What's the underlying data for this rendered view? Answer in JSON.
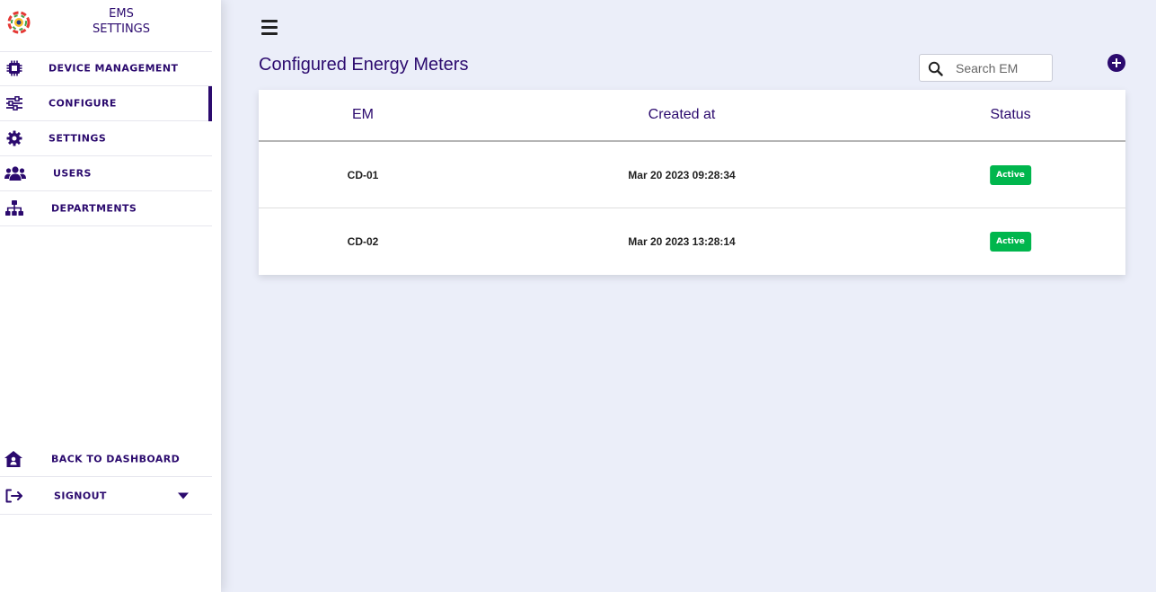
{
  "brand": {
    "line1": "EMS",
    "line2": "SETTINGS"
  },
  "sidebar": {
    "items": [
      {
        "label": "DEVICE MANAGEMENT",
        "icon": "chip-icon"
      },
      {
        "label": "CONFIGURE",
        "icon": "sliders-icon",
        "active": true
      },
      {
        "label": "SETTINGS",
        "icon": "gear-icon"
      },
      {
        "label": "USERS",
        "icon": "users-icon"
      },
      {
        "label": "DEPARTMENTS",
        "icon": "sitemap-icon"
      }
    ],
    "bottom": [
      {
        "label": "BACK TO DASHBOARD",
        "icon": "house-user-icon"
      },
      {
        "label": "SIGNOUT",
        "icon": "sign-out-icon"
      }
    ]
  },
  "main": {
    "title": "Configured Energy Meters",
    "search": {
      "placeholder": "Search EM"
    },
    "table": {
      "headers": [
        "EM",
        "Created at",
        "Status"
      ],
      "rows": [
        {
          "em": "CD-01",
          "created_at": "Mar 20 2023 09:28:34",
          "status": "Active"
        },
        {
          "em": "CD-02",
          "created_at": "Mar 20 2023 13:28:14",
          "status": "Active"
        }
      ]
    }
  },
  "colors": {
    "accent": "#2b0a6e",
    "active_badge": "#00b64d",
    "background": "#ebeef9"
  }
}
